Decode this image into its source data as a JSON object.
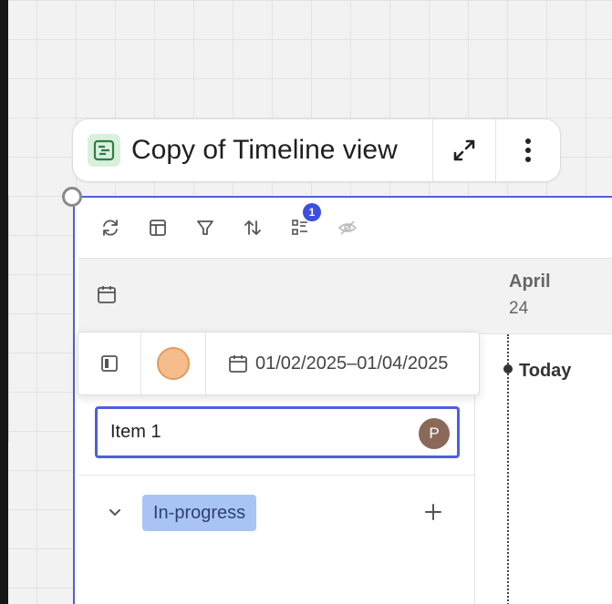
{
  "title_pill": {
    "title": "Copy of Timeline view",
    "doc_icon": "timeline-doc-icon",
    "expand_icon": "expand-icon",
    "more_icon": "more-vertical-icon"
  },
  "toolbar": {
    "icons": [
      "refresh-icon",
      "layout-icon",
      "filter-icon",
      "sort-icon",
      "group-icon",
      "hide-icon"
    ],
    "group_badge": "1"
  },
  "header": {
    "month": "April",
    "day": "24"
  },
  "timeline": {
    "today_label": "Today"
  },
  "item_bar": {
    "date_range": "01/02/2025–01/04/2025",
    "color": "#f6bd8c"
  },
  "item": {
    "name": "Item 1",
    "avatar_initial": "P"
  },
  "group": {
    "status": "In-progress"
  },
  "colors": {
    "accent": "#4f5fe0",
    "status_tag": "#a8c4f5",
    "avatar": "#8a6958"
  }
}
